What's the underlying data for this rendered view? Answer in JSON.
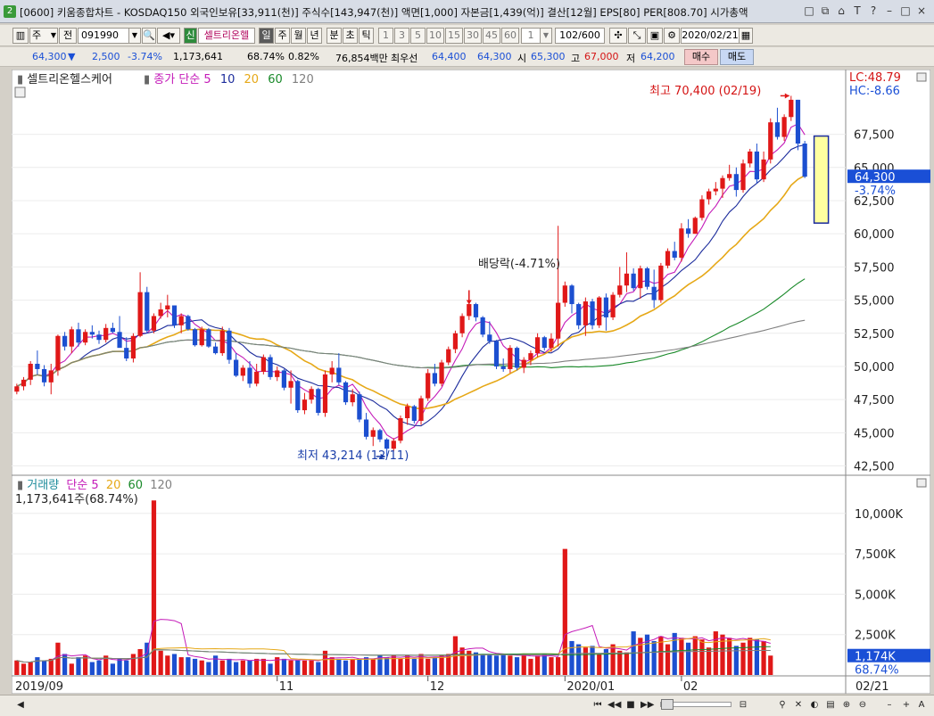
{
  "window": {
    "badge": "2",
    "title": "[0600] 키움종합차트 - KOSDAQ150 외국인보유[33,911(천)] 주식수[143,947(천)] 액면[1,000] 자본금[1,439(억)] 결산[12월] EPS[80] PER[808.70] 시가총액",
    "controls": [
      "□",
      "⧉",
      "⌂",
      "T",
      "?",
      "–",
      "□",
      "×"
    ]
  },
  "toolbar": {
    "period": "주",
    "prev": "전",
    "code": "091990",
    "new_badge": "신",
    "stock_name": "셀트리온헬",
    "periods": [
      "일",
      "주",
      "월",
      "년",
      "분",
      "초",
      "틱"
    ],
    "active_period": "일",
    "intervals": [
      "1",
      "3",
      "5",
      "10",
      "15",
      "30",
      "45",
      "60"
    ],
    "count_value": "1",
    "range": "102/600",
    "date": "2020/02/21"
  },
  "quote": {
    "price": "64,300",
    "arrow": "▼",
    "change": "2,500",
    "change_pct": "-3.74%",
    "volume": "1,173,641",
    "vol_ratio": "68.74%",
    "turnover_pct": "0.82%",
    "amount": "76,854백만",
    "best_label": "최우선",
    "best_sell": "64,400",
    "best_buy": "64,300",
    "open_label": "시",
    "open": "65,300",
    "high_label": "고",
    "high": "67,000",
    "low_label": "저",
    "low": "64,200",
    "buy_label": "매수",
    "sell_label": "매도"
  },
  "colors": {
    "up": "#e01818",
    "down": "#1c4fd0",
    "ma5": "#c41ab8",
    "ma10": "#1c2c9c",
    "ma20": "#e6a817",
    "ma60": "#1a8a2a",
    "ma120": "#808080"
  },
  "chart_data": {
    "type": "candlestick",
    "x_labels": [
      "2019/09",
      "11",
      "12",
      "2020/01",
      "02",
      "02/21"
    ],
    "price_panel": {
      "legend_name": "셀트리온헬스케어",
      "legend_prefix": "종가 단순",
      "ma_periods": [
        "5",
        "10",
        "20",
        "60",
        "120"
      ],
      "lc_label": "LC:48.79",
      "hc_label": "HC:-8.66",
      "y_ticks": [
        "67,500",
        "65,000",
        "62,500",
        "60,000",
        "57,500",
        "55,000",
        "52,500",
        "50,000",
        "47,500",
        "45,000",
        "42,500"
      ],
      "ylim": [
        42000,
        70900
      ],
      "current_price": "64,300",
      "current_change": "-3.74%",
      "annotation_high": "최고 70,400 (02/19)",
      "annotation_low": "최저 43,214 (12/11)",
      "annotation_dividend": "배당락(-4.71%)",
      "candles": [
        [
          48100,
          48700,
          47900,
          48500
        ],
        [
          48500,
          49200,
          48200,
          49000
        ],
        [
          49000,
          50400,
          48600,
          50200
        ],
        [
          50200,
          51200,
          49400,
          49800
        ],
        [
          49800,
          50100,
          48500,
          48800
        ],
        [
          48800,
          50200,
          47900,
          49700
        ],
        [
          49700,
          52400,
          49300,
          52300
        ],
        [
          52300,
          52600,
          51200,
          51500
        ],
        [
          51500,
          53000,
          51000,
          52800
        ],
        [
          52800,
          53300,
          51500,
          51800
        ],
        [
          51800,
          52800,
          51600,
          52600
        ],
        [
          52600,
          53100,
          52100,
          52400
        ],
        [
          52400,
          52700,
          51700,
          52000
        ],
        [
          52000,
          53200,
          51800,
          52900
        ],
        [
          52900,
          53300,
          52500,
          52600
        ],
        [
          52600,
          53800,
          51500,
          51400
        ],
        [
          51400,
          52200,
          50400,
          50600
        ],
        [
          50600,
          52500,
          50300,
          52300
        ],
        [
          52300,
          57100,
          52200,
          55600
        ],
        [
          55600,
          56000,
          52500,
          52700
        ],
        [
          52700,
          54000,
          52500,
          53800
        ],
        [
          53800,
          54800,
          53600,
          54300
        ],
        [
          54300,
          55400,
          53700,
          54600
        ],
        [
          54600,
          54600,
          52900,
          53100
        ],
        [
          53100,
          54000,
          52500,
          53800
        ],
        [
          53800,
          53900,
          52700,
          52800
        ],
        [
          52800,
          52900,
          51500,
          51600
        ],
        [
          51600,
          53000,
          51500,
          52800
        ],
        [
          52800,
          52900,
          51400,
          51500
        ],
        [
          51500,
          51800,
          50900,
          51000
        ],
        [
          51000,
          53000,
          50800,
          52700
        ],
        [
          52700,
          52900,
          50200,
          50500
        ],
        [
          50500,
          51000,
          49200,
          49300
        ],
        [
          49300,
          50100,
          48900,
          49900
        ],
        [
          49900,
          50400,
          48400,
          48700
        ],
        [
          48700,
          50200,
          48500,
          49600
        ],
        [
          49600,
          50900,
          49400,
          50700
        ],
        [
          50700,
          50900,
          49000,
          49200
        ],
        [
          49200,
          50000,
          48900,
          49700
        ],
        [
          49700,
          49800,
          48200,
          48400
        ],
        [
          48400,
          49700,
          47200,
          48900
        ],
        [
          48900,
          49000,
          46500,
          46700
        ],
        [
          46700,
          48000,
          46400,
          47500
        ],
        [
          47500,
          48500,
          47200,
          48300
        ],
        [
          48300,
          48400,
          46300,
          46500
        ],
        [
          46500,
          49700,
          46200,
          49400
        ],
        [
          49400,
          50400,
          48800,
          49900
        ],
        [
          49900,
          51000,
          48600,
          48800
        ],
        [
          48800,
          48900,
          47100,
          47300
        ],
        [
          47300,
          48300,
          47000,
          47900
        ],
        [
          47900,
          48100,
          45800,
          46000
        ],
        [
          46000,
          46500,
          44500,
          44700
        ],
        [
          44700,
          45400,
          44000,
          45200
        ],
        [
          45200,
          45300,
          44300,
          44500
        ],
        [
          44500,
          44600,
          43214,
          43800
        ],
        [
          43800,
          44600,
          43600,
          44400
        ],
        [
          44400,
          46300,
          44200,
          46100
        ],
        [
          46100,
          47200,
          45600,
          47000
        ],
        [
          47000,
          47100,
          45700,
          45900
        ],
        [
          45900,
          47800,
          45600,
          47600
        ],
        [
          47600,
          49800,
          47400,
          49500
        ],
        [
          49500,
          50200,
          48500,
          48700
        ],
        [
          48700,
          50500,
          48500,
          50300
        ],
        [
          50300,
          51500,
          50100,
          51300
        ],
        [
          51300,
          52700,
          51000,
          52500
        ],
        [
          52500,
          54000,
          52200,
          53800
        ],
        [
          53800,
          55600,
          53500,
          54700
        ],
        [
          54700,
          54800,
          53400,
          53700
        ],
        [
          53700,
          53800,
          52200,
          52400
        ],
        [
          52400,
          53400,
          51700,
          51900
        ],
        [
          51900,
          52000,
          49800,
          50000
        ],
        [
          50000,
          50600,
          49600,
          49800
        ],
        [
          49800,
          51600,
          49500,
          51400
        ],
        [
          51400,
          51500,
          49700,
          49900
        ],
        [
          49900,
          50700,
          49500,
          50500
        ],
        [
          50500,
          51200,
          50100,
          51000
        ],
        [
          51000,
          52500,
          50700,
          52200
        ],
        [
          52200,
          52300,
          51200,
          51400
        ],
        [
          51400,
          52500,
          51100,
          52100
        ],
        [
          52100,
          60600,
          51500,
          54800
        ],
        [
          54800,
          56400,
          54500,
          56100
        ],
        [
          56100,
          56200,
          54000,
          54700
        ],
        [
          54700,
          54800,
          52800,
          53100
        ],
        [
          53100,
          55200,
          52300,
          54900
        ],
        [
          54900,
          55100,
          52800,
          53100
        ],
        [
          53100,
          55300,
          52900,
          55200
        ],
        [
          55200,
          55500,
          52700,
          53700
        ],
        [
          53700,
          55600,
          53500,
          55400
        ],
        [
          55400,
          57500,
          55200,
          56100
        ],
        [
          56100,
          58600,
          55600,
          57000
        ],
        [
          57000,
          57400,
          55700,
          55900
        ],
        [
          55900,
          57600,
          55100,
          57400
        ],
        [
          57400,
          57500,
          55800,
          56000
        ],
        [
          56000,
          57300,
          54400,
          55000
        ],
        [
          55000,
          57800,
          54800,
          57600
        ],
        [
          57600,
          58900,
          57400,
          58700
        ],
        [
          58700,
          59400,
          58000,
          58200
        ],
        [
          58200,
          60800,
          57900,
          60400
        ],
        [
          60400,
          61100,
          59700,
          60000
        ],
        [
          60000,
          61300,
          60000,
          61200
        ],
        [
          61200,
          62900,
          61000,
          62600
        ],
        [
          62600,
          63400,
          62200,
          63200
        ],
        [
          63200,
          63900,
          62900,
          63400
        ],
        [
          63400,
          64400,
          62700,
          64200
        ],
        [
          64200,
          65200,
          64000,
          64500
        ],
        [
          64500,
          65000,
          62800,
          63300
        ],
        [
          63300,
          65600,
          63100,
          65300
        ],
        [
          65300,
          66400,
          65000,
          66200
        ],
        [
          66200,
          66800,
          63800,
          64100
        ],
        [
          64100,
          66200,
          63900,
          65600
        ],
        [
          65600,
          68700,
          65300,
          68400
        ],
        [
          68400,
          69500,
          67100,
          67300
        ],
        [
          67300,
          69000,
          67000,
          68800
        ],
        [
          68800,
          70400,
          68500,
          70100
        ],
        [
          70100,
          70100,
          66300,
          66800
        ],
        [
          66800,
          67000,
          64200,
          64300
        ]
      ]
    },
    "volume_panel": {
      "legend_name": "거래량",
      "legend_prefix": "단순",
      "ma_periods": [
        "5",
        "20",
        "60",
        "120"
      ],
      "current_label": "1,173,641주(68.74%)",
      "y_ticks": [
        "10,000K",
        "7,500K",
        "5,000K",
        "2,500K"
      ],
      "ylim": [
        0,
        11200
      ],
      "current_volume": "1,174K",
      "current_ratio": "68.74%",
      "volumes_k": [
        900,
        700,
        800,
        1100,
        900,
        1000,
        2000,
        1300,
        700,
        1100,
        1200,
        800,
        900,
        1200,
        700,
        1000,
        900,
        1300,
        1600,
        2000,
        10800,
        1500,
        1200,
        1300,
        1100,
        1100,
        1000,
        900,
        800,
        1200,
        900,
        1000,
        800,
        900,
        900,
        1000,
        1000,
        700,
        1100,
        1000,
        900,
        900,
        900,
        900,
        800,
        1500,
        1100,
        1000,
        900,
        1000,
        1000,
        1100,
        1000,
        1200,
        1100,
        1200,
        1000,
        1200,
        1000,
        1300,
        1000,
        1100,
        1200,
        1300,
        2400,
        1700,
        1500,
        1400,
        1300,
        1300,
        1200,
        1300,
        1200,
        1100,
        1300,
        1000,
        1200,
        1300,
        1100,
        1100,
        7800,
        2100,
        1900,
        1700,
        1800,
        1300,
        1600,
        1900,
        1500,
        1400,
        2700,
        2300,
        2500,
        2100,
        2400,
        1900,
        2600,
        2300,
        2000,
        2400,
        2200,
        1700,
        2700,
        2500,
        2300,
        1800,
        2000,
        2300,
        2200,
        2100,
        1200
      ]
    }
  }
}
